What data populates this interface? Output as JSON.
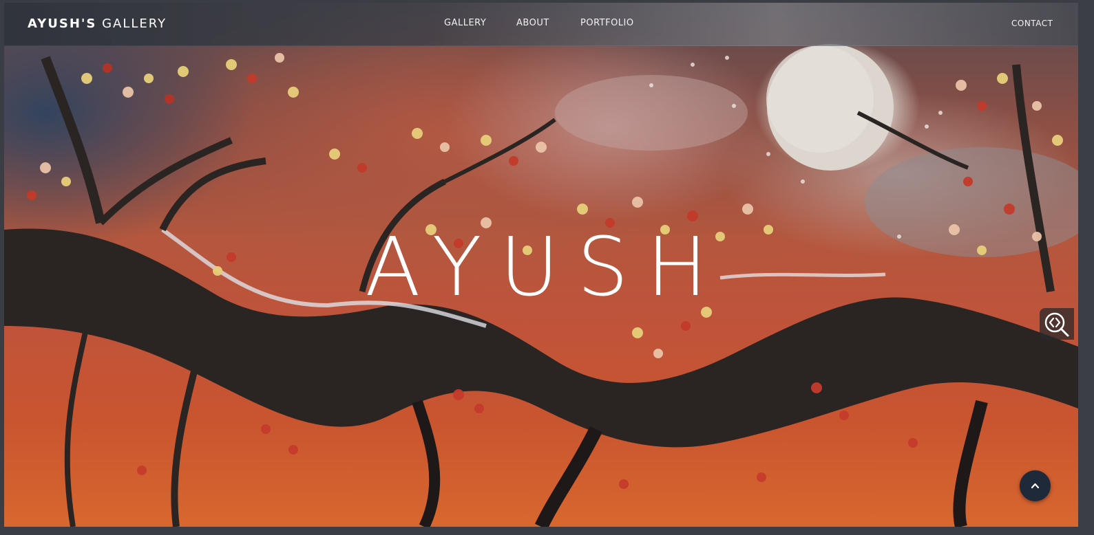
{
  "header": {
    "brand_bold": "AYUSH'S",
    "brand_light": "GALLERY",
    "nav": [
      {
        "label": "GALLERY"
      },
      {
        "label": "ABOUT"
      },
      {
        "label": "PORTFOLIO"
      }
    ],
    "contact_label": "CONTACT"
  },
  "hero": {
    "headline": "AYUSH"
  },
  "icons": {
    "zoom": "zoom-code-icon",
    "back_to_top": "chevron-up-icon"
  },
  "colors": {
    "back_to_top_bg": "#1e2a3a",
    "headline": "#ffffff"
  }
}
